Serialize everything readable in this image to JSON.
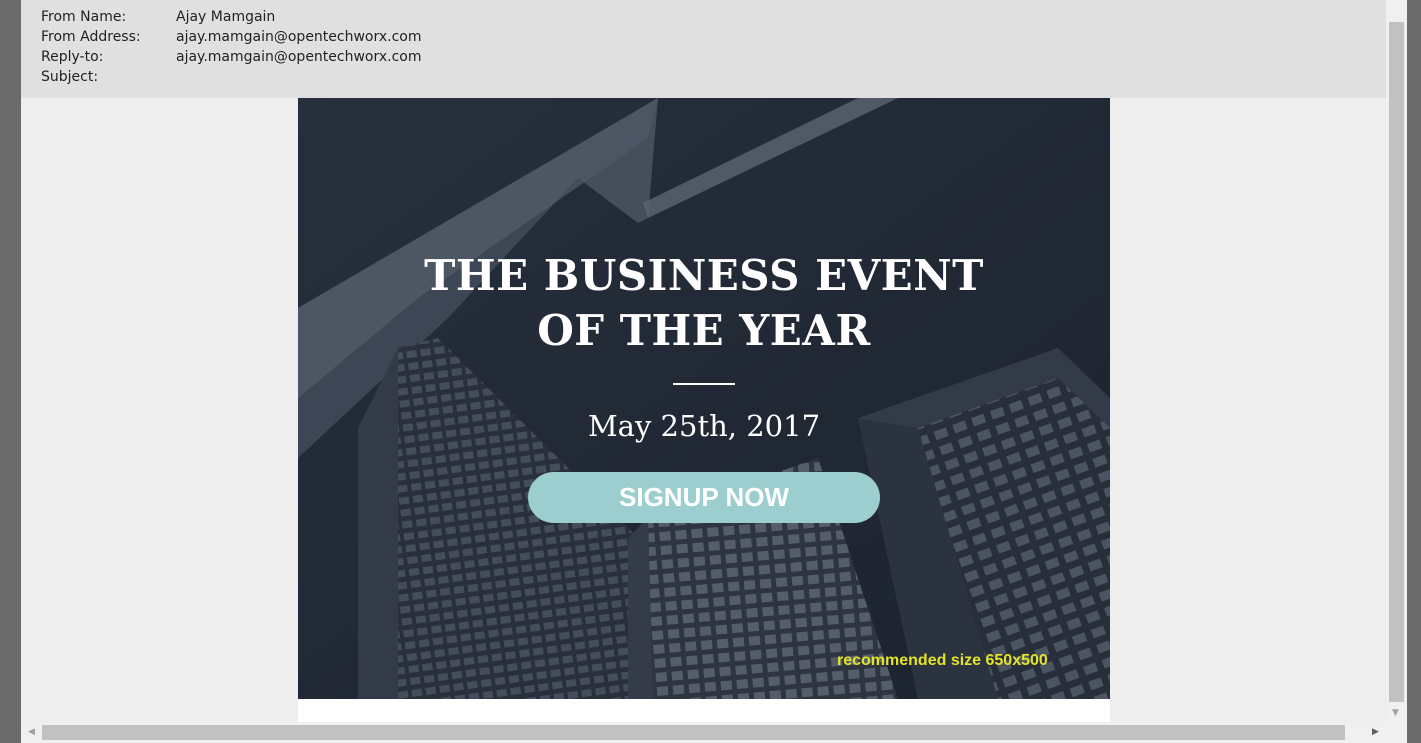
{
  "header": {
    "from_name_label": "From Name:",
    "from_name_value": "Ajay Mamgain",
    "from_address_label": "From Address:",
    "from_address_value": "ajay.mamgain@opentechworx.com",
    "reply_to_label": "Reply-to:",
    "reply_to_value": "ajay.mamgain@opentechworx.com",
    "subject_label": "Subject:",
    "subject_value": ""
  },
  "hero": {
    "title_line1": "THE BUSINESS EVENT",
    "title_line2": "OF THE YEAR",
    "date": "May 25th, 2017",
    "button_label": "SIGNUP NOW",
    "size_note": "recommended size 650x500",
    "background_description_icon": "skyscraper-photo",
    "colors": {
      "overlay": "#1e2632",
      "button": "#9ccdcf",
      "size_note": "#e3e32a"
    }
  },
  "scrollbars": {
    "arrow_down": "▼",
    "arrow_left": "◀",
    "arrow_right": "▶"
  }
}
